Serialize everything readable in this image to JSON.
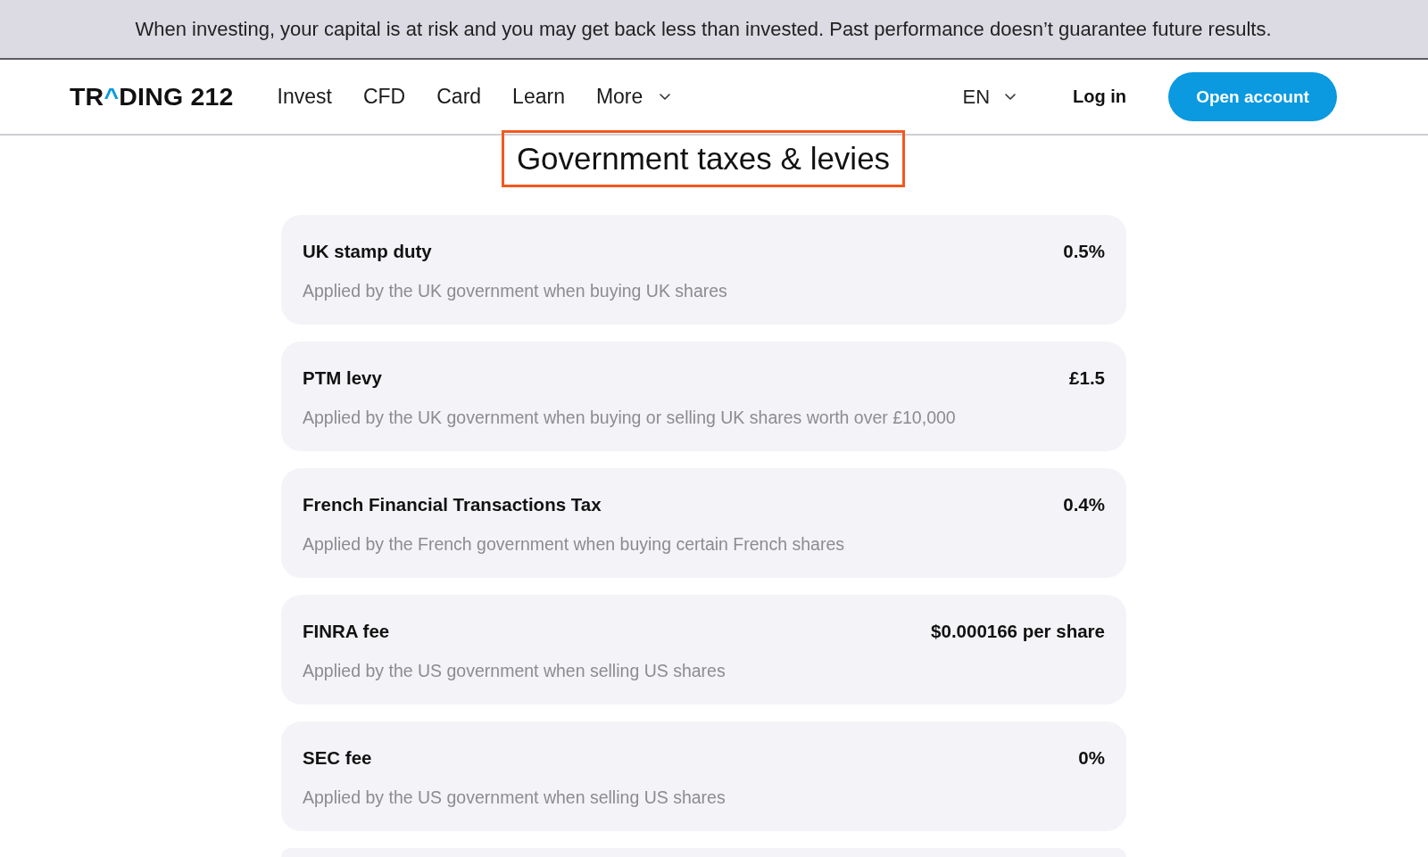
{
  "banner": {
    "text": "When investing, your capital is at risk and you may get back less than invested. Past performance doesn’t guarantee future results."
  },
  "header": {
    "logo": {
      "segments": [
        {
          "text": "TR",
          "color": "#111111"
        },
        {
          "text": "^",
          "color": "#0a9ae0"
        },
        {
          "text": "DING 212",
          "color": "#111111"
        }
      ]
    },
    "nav": [
      {
        "label": "Invest",
        "kind": "link"
      },
      {
        "label": "CFD",
        "kind": "link"
      },
      {
        "label": "Card",
        "kind": "link"
      },
      {
        "label": "Learn",
        "kind": "link"
      },
      {
        "label": "More",
        "kind": "menu"
      }
    ],
    "language": {
      "label": "EN"
    },
    "login": {
      "label": "Log in"
    },
    "cta": {
      "label": "Open account"
    }
  },
  "section": {
    "title": "Government taxes & levies",
    "highlighted": true
  },
  "fees": [
    {
      "name": "UK stamp duty",
      "value": "0.5%",
      "description": "Applied by the UK government when buying UK shares"
    },
    {
      "name": "PTM levy",
      "value": "£1.5",
      "description": "Applied by the UK government when buying or selling UK shares worth over £10,000"
    },
    {
      "name": "French Financial Transactions Tax",
      "value": "0.4%",
      "description": "Applied by the French government when buying certain French shares"
    },
    {
      "name": "FINRA fee",
      "value": "$0.000166 per share",
      "description": "Applied by the US government when selling US shares"
    },
    {
      "name": "SEC fee",
      "value": "0%",
      "description": "Applied by the US government when selling US shares"
    }
  ]
}
